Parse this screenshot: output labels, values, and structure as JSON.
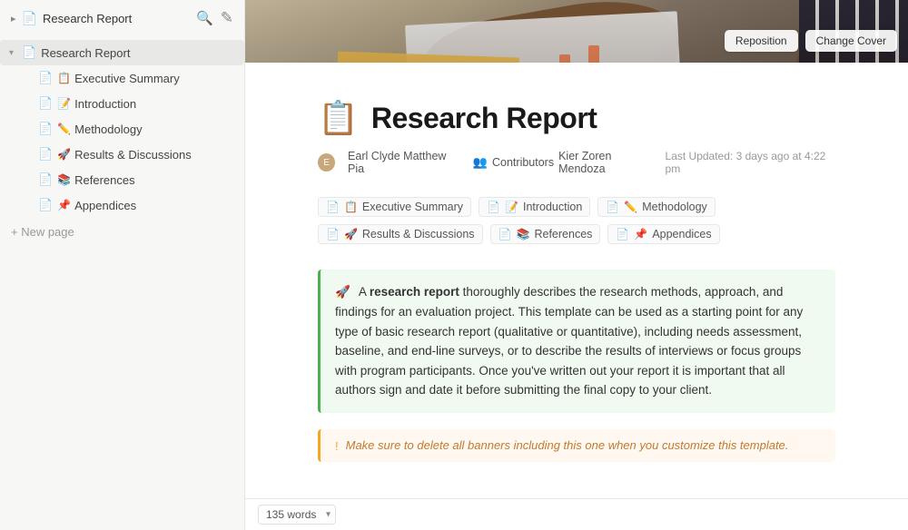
{
  "app": {
    "title": "Research Report"
  },
  "sidebar": {
    "header_title": "Research Report",
    "items": [
      {
        "id": "research-report",
        "label": "Research Report",
        "icon": "📄",
        "level": 0,
        "is_root": true,
        "has_arrow": true,
        "arrow_open": true
      },
      {
        "id": "executive-summary",
        "label": "Executive Summary",
        "icon": "📋",
        "level": 1
      },
      {
        "id": "introduction",
        "label": "Introduction",
        "icon": "📝",
        "level": 1
      },
      {
        "id": "methodology",
        "label": "Methodology",
        "icon": "✏️",
        "level": 1
      },
      {
        "id": "results-discussions",
        "label": "Results & Discussions",
        "icon": "🚀",
        "level": 1
      },
      {
        "id": "references",
        "label": "References",
        "icon": "📚",
        "level": 1
      },
      {
        "id": "appendices",
        "label": "Appendices",
        "icon": "📌",
        "level": 1
      }
    ],
    "new_page_label": "+ New page"
  },
  "cover": {
    "reposition_label": "Reposition",
    "change_cover_label": "Change Cover"
  },
  "page": {
    "emoji": "📋",
    "title": "Research Report",
    "author_name": "Earl Clyde Matthew Pia",
    "contributors_label": "Contributors",
    "contributors_name": "Kier Zoren Mendoza",
    "updated_label": "Last Updated: 3 days ago at 4:22 pm",
    "sub_pages": [
      {
        "icon": "📋",
        "label": "Executive Summary"
      },
      {
        "icon": "📝",
        "label": "Introduction"
      },
      {
        "icon": "✏️",
        "label": "Methodology"
      },
      {
        "icon": "🚀",
        "label": "Results & Discussions"
      },
      {
        "icon": "📚",
        "label": "References"
      },
      {
        "icon": "📌",
        "label": "Appendices"
      }
    ],
    "callout_green": {
      "icon": "🚀",
      "text_before": "A ",
      "bold_text": "research report",
      "text_after": " thoroughly describes the research methods, approach, and findings for an evaluation project. This template can be used as a starting point for any type of basic research report (qualitative or quantitative), including needs assessment, baseline, and end-line surveys, or to describe the results of interviews or focus groups with program participants. Once you've written out your report it is important that all authors sign and date it before submitting the final copy to your client."
    },
    "callout_orange": {
      "icon": "!",
      "text": "Make sure to delete all banners including this one when you customize this template."
    }
  },
  "footer": {
    "word_count": "135 words"
  }
}
